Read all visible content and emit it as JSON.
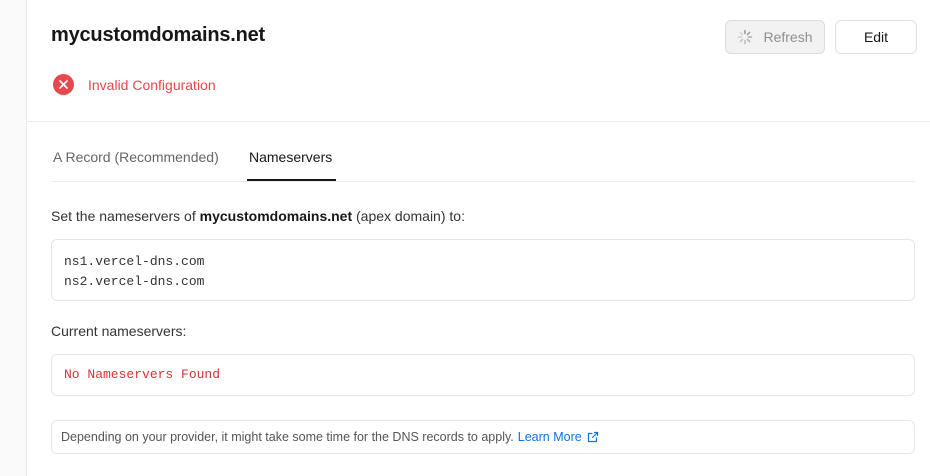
{
  "domain": {
    "name": "mycustomdomains.net",
    "status_label": "Invalid Configuration",
    "status_color": "#e5484d"
  },
  "actions": {
    "refresh_label": "Refresh",
    "edit_label": "Edit"
  },
  "tabs": [
    {
      "label": "A Record (Recommended)",
      "active": false
    },
    {
      "label": "Nameservers",
      "active": true
    }
  ],
  "instructions": {
    "prefix": "Set the nameservers of ",
    "domain": "mycustomdomains.net",
    "suffix": " (apex domain) to:"
  },
  "required_nameservers": [
    "ns1.vercel-dns.com",
    "ns2.vercel-dns.com"
  ],
  "current": {
    "label": "Current nameservers:",
    "value": "No Nameservers Found",
    "value_color": "#d93036"
  },
  "note": {
    "text": "Depending on your provider, it might take some time for the DNS records to apply.",
    "link_label": "Learn More",
    "link_color": "#0a72ef"
  },
  "icons": {
    "status": "x-circle-icon",
    "refresh": "spinner-icon",
    "link": "external-link-icon"
  }
}
